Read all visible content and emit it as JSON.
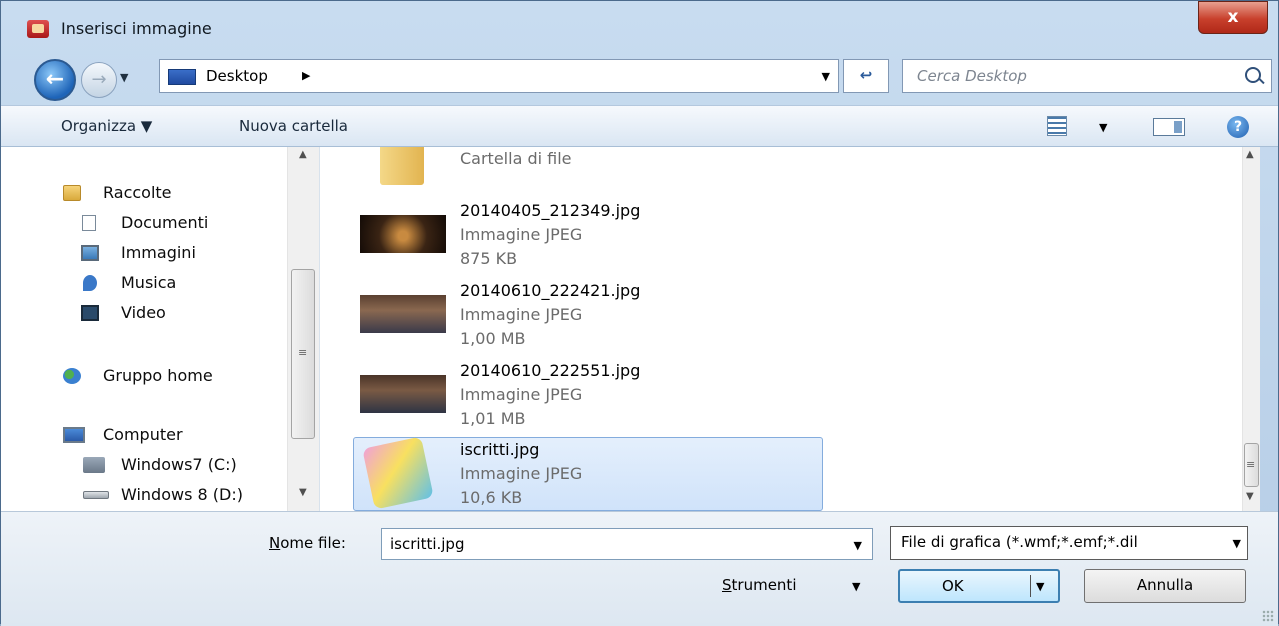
{
  "window": {
    "title": "Inserisci immagine",
    "close_label": "x"
  },
  "nav": {
    "back_glyph": "←",
    "forward_glyph": "→",
    "history_drop": "▼",
    "address": "Desktop",
    "address_arrow": "▶",
    "address_drop": "▼",
    "refresh_glyph": "↩",
    "search_placeholder": "Cerca Desktop"
  },
  "toolbar": {
    "organize": "Organizza ▼",
    "new_folder": "Nuova cartella",
    "views_drop": "▼",
    "help": "?"
  },
  "sidebar": {
    "libraries": "Raccolte",
    "documents": "Documenti",
    "pictures": "Immagini",
    "music": "Musica",
    "video": "Video",
    "homegroup": "Gruppo home",
    "computer": "Computer",
    "drive_c": "Windows7 (C:)",
    "drive_d": "Windows 8 (D:)",
    "scroll_up": "▲",
    "scroll_down": "▼",
    "scroll_grip": "≡"
  },
  "files": {
    "folder_type": "Cartella di file",
    "items": [
      {
        "name": "20140405_212349.jpg",
        "type": "Immagine JPEG",
        "size": "875 KB"
      },
      {
        "name": "20140610_222421.jpg",
        "type": "Immagine JPEG",
        "size": "1,00 MB"
      },
      {
        "name": "20140610_222551.jpg",
        "type": "Immagine JPEG",
        "size": "1,01 MB"
      },
      {
        "name": "iscritti.jpg",
        "type": "Immagine JPEG",
        "size": "10,6 KB"
      }
    ],
    "scroll_up": "▲",
    "scroll_down": "▼",
    "scroll_grip": "≡"
  },
  "footer": {
    "filename_label_key": "N",
    "filename_label_rest": "ome file:",
    "filename_value": "iscritti.jpg",
    "filename_drop": "▼",
    "filter": "File di grafica (*.wmf;*.emf;*.dil",
    "filter_drop": "▼",
    "tools_key": "S",
    "tools_rest": "trumenti",
    "tools_drop": "▼",
    "ok": "OK",
    "ok_drop": "▼",
    "cancel": "Annulla"
  }
}
